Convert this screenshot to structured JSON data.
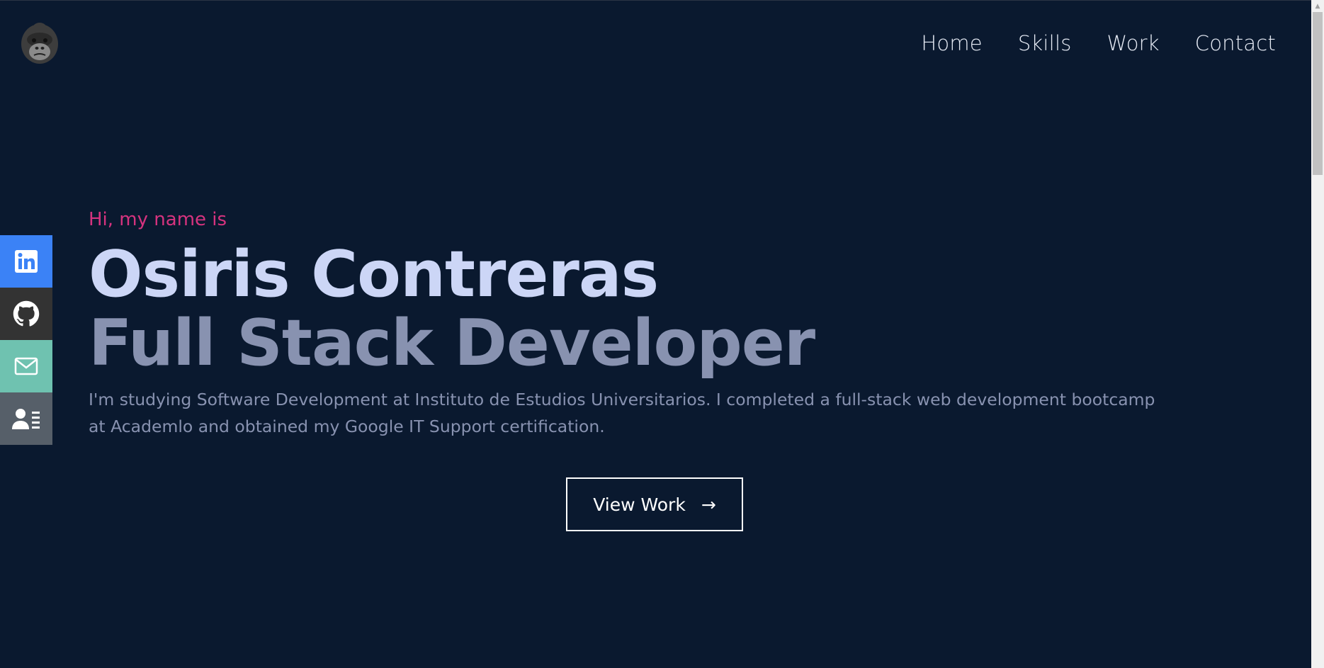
{
  "nav": {
    "items": [
      {
        "label": "Home"
      },
      {
        "label": "Skills"
      },
      {
        "label": "Work"
      },
      {
        "label": "Contact"
      }
    ]
  },
  "social": [
    {
      "icon": "linkedin-icon",
      "color": "#3b82f6"
    },
    {
      "icon": "github-icon",
      "color": "#333333"
    },
    {
      "icon": "mail-icon",
      "color": "#6fc2b0"
    },
    {
      "icon": "resume-icon",
      "color": "#565f69"
    }
  ],
  "hero": {
    "greeting": "Hi, my name is",
    "name": "Osiris Contreras",
    "role": "Full Stack Developer",
    "bio": "I'm studying Software Development at Instituto de Estudios Universitarios. I completed a full-stack web development bootcamp at Academlo and obtained my Google IT Support certification.",
    "cta_label": "View Work",
    "cta_arrow": "→"
  },
  "colors": {
    "background": "#0a192f",
    "accent": "#d6337f",
    "name": "#ccd6f6",
    "muted": "#8892b0"
  }
}
